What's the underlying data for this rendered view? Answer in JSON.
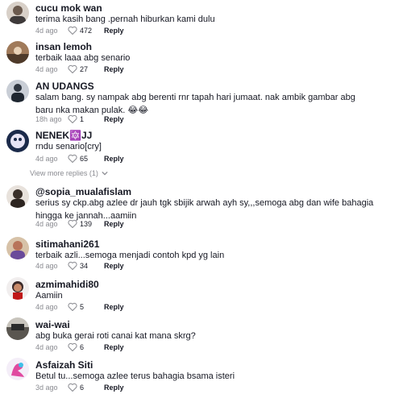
{
  "comments": [
    {
      "user": "cucu mok wan",
      "text": "terima kasih bang .pernah hiburkan kami dulu",
      "time": "4d ago",
      "likes": "472",
      "reply": "Reply"
    },
    {
      "user": "insan lemoh",
      "text": "terbaik laaa abg senario",
      "time": "4d ago",
      "likes": "27",
      "reply": "Reply"
    },
    {
      "user": "AN UDANGS",
      "text": "salam bang. sy nampak abg berenti rnr tapah hari jumaat. nak ambik gambar abg baru nka makan pulak. 😂😂",
      "time": "18h ago",
      "likes": "1",
      "reply": "Reply"
    },
    {
      "user": "NENEK🔯JJ",
      "text": "rndu senario[cry]",
      "time": "4d ago",
      "likes": "65",
      "reply": "Reply"
    },
    {
      "user": "@sopia_mualafislam",
      "text": "serius sy ckp.abg azlee dr jauh tgk sbijik arwah ayh sy,,,semoga abg dan wife bahagia hingga ke jannah...aamiin",
      "time": "4d ago",
      "likes": "139",
      "reply": "Reply"
    },
    {
      "user": "sitimahani261",
      "text": "terbaik azli...semoga menjadi contoh kpd yg lain",
      "time": "4d ago",
      "likes": "34",
      "reply": "Reply"
    },
    {
      "user": "azmimahidi80",
      "text": "Aamiin",
      "time": "4d ago",
      "likes": "5",
      "reply": "Reply"
    },
    {
      "user": "wai-wai",
      "text": "abg buka gerai roti canai kat mana skrg?",
      "time": "4d ago",
      "likes": "6",
      "reply": "Reply"
    },
    {
      "user": "Asfaizah Siti",
      "text": "Betul tu...semoga azlee terus bahagia bsama isteri",
      "time": "3d ago",
      "likes": "6",
      "reply": "Reply"
    }
  ],
  "view_more": "View more replies (1)",
  "icons": {
    "like": "heart-outline-icon",
    "expand": "chevron-down-icon"
  }
}
